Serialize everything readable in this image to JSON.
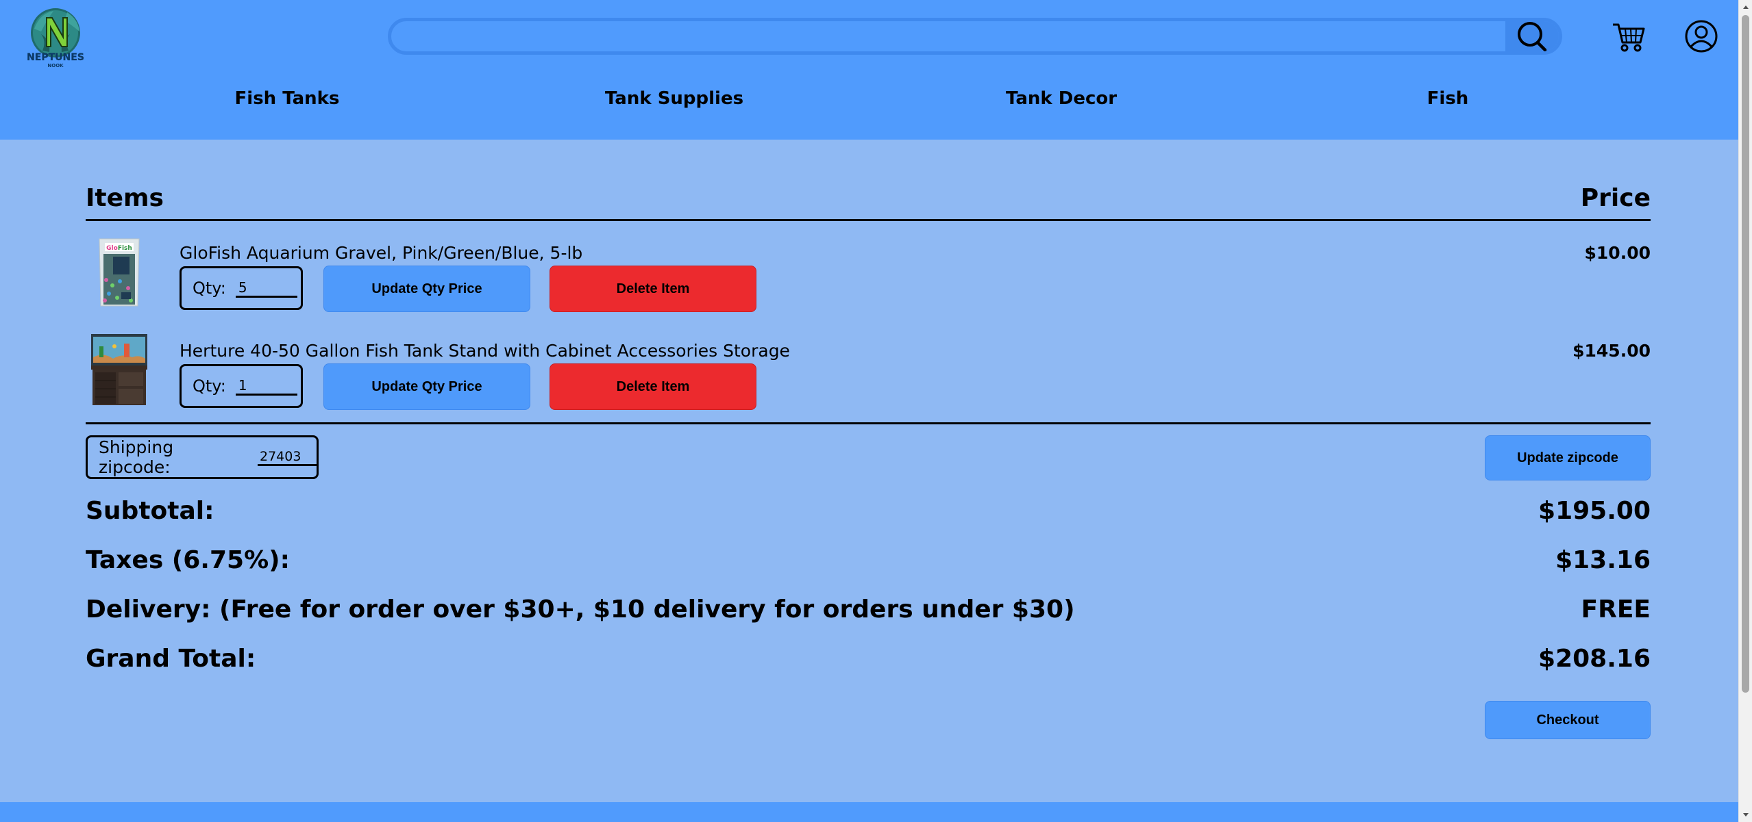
{
  "brand": {
    "name": "Neptunes Nook",
    "logo_top": "NEPTUNES",
    "logo_bottom": "NOOK"
  },
  "search": {
    "placeholder": "",
    "value": ""
  },
  "icons": {
    "search": "search-icon",
    "cart": "cart-icon",
    "account": "account-icon"
  },
  "nav": {
    "items": [
      {
        "label": "Fish Tanks"
      },
      {
        "label": "Tank Supplies"
      },
      {
        "label": "Tank Decor"
      },
      {
        "label": "Fish"
      }
    ]
  },
  "cart": {
    "items_header": "Items",
    "price_header": "Price",
    "qty_label": "Qty:",
    "update_label": "Update Qty Price",
    "delete_label": "Delete Item",
    "items": [
      {
        "name": "GloFish Aquarium Gravel, Pink/Green/Blue, 5-lb",
        "qty": "5",
        "price": "$10.00"
      },
      {
        "name": "Herture 40-50 Gallon Fish Tank Stand with Cabinet Accessories Storage",
        "qty": "1",
        "price": "$145.00"
      }
    ]
  },
  "shipping": {
    "label": "Shipping zipcode:",
    "zipcode": "27403",
    "update_label": "Update zipcode"
  },
  "summary": {
    "subtotal_label": "Subtotal:",
    "subtotal": "$195.00",
    "taxes_label": "Taxes (6.75%):",
    "taxes": "$13.16",
    "delivery_label": "Delivery: (Free for order over $30+, $10 delivery for orders under $30)",
    "delivery": "FREE",
    "grand_total_label": "Grand Total:",
    "grand_total": "$208.16"
  },
  "checkout": {
    "label": "Checkout"
  },
  "colors": {
    "header_bg": "#509bfd",
    "page_bg": "#8fb9f3",
    "button_blue": "#4f9afb",
    "button_red": "#ec2a2e"
  }
}
